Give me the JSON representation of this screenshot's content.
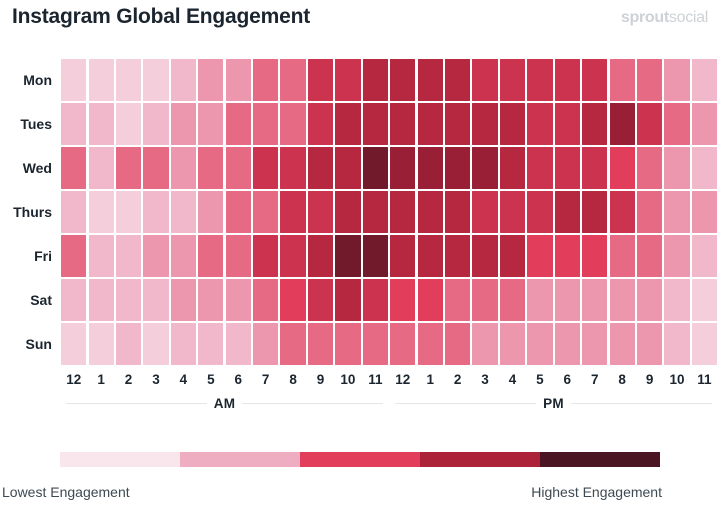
{
  "header": {
    "title": "Instagram Global Engagement",
    "brand_strong": "sprout",
    "brand_light": "social"
  },
  "legend": {
    "low_label": "Lowest Engagement",
    "high_label": "Highest Engagement",
    "swatches": [
      "#f8e6ec",
      "#eeadc1",
      "#e23e5c",
      "#ab2239",
      "#4a1423"
    ]
  },
  "axis": {
    "am_label": "AM",
    "pm_label": "PM",
    "hours": [
      "12",
      "1",
      "2",
      "3",
      "4",
      "5",
      "6",
      "7",
      "8",
      "9",
      "10",
      "11",
      "12",
      "1",
      "2",
      "3",
      "4",
      "5",
      "6",
      "7",
      "8",
      "9",
      "10",
      "11"
    ]
  },
  "chart_data": {
    "type": "heatmap",
    "title": "Instagram Global Engagement",
    "xlabel": "",
    "ylabel": "",
    "x": [
      "12 AM",
      "1 AM",
      "2 AM",
      "3 AM",
      "4 AM",
      "5 AM",
      "6 AM",
      "7 AM",
      "8 AM",
      "9 AM",
      "10 AM",
      "11 AM",
      "12 PM",
      "1 PM",
      "2 PM",
      "3 PM",
      "4 PM",
      "5 PM",
      "6 PM",
      "7 PM",
      "8 PM",
      "9 PM",
      "10 PM",
      "11 PM"
    ],
    "y": [
      "Mon",
      "Tues",
      "Wed",
      "Thurs",
      "Fri",
      "Sat",
      "Sun"
    ],
    "zmin": 0,
    "zmax": 10,
    "colorscale": [
      "#f8e6ec",
      "#eeadc1",
      "#e23e5c",
      "#ab2239",
      "#4a1423"
    ],
    "legend_position": "bottom",
    "grid": false,
    "annotations": [
      "Lowest Engagement",
      "Highest Engagement"
    ],
    "values": [
      [
        1,
        1,
        1,
        1,
        2,
        3,
        3,
        4,
        4,
        6,
        6,
        7,
        7,
        7,
        7,
        6,
        6,
        6,
        6,
        6,
        4,
        4,
        3,
        2
      ],
      [
        2,
        2,
        1,
        2,
        3,
        3,
        4,
        4,
        4,
        6,
        7,
        7,
        7,
        7,
        7,
        7,
        7,
        6,
        6,
        7,
        8,
        6,
        4,
        3
      ],
      [
        4,
        2,
        4,
        4,
        3,
        4,
        4,
        6,
        6,
        7,
        7,
        9,
        8,
        8,
        8,
        8,
        7,
        6,
        6,
        6,
        5,
        4,
        3,
        2
      ],
      [
        2,
        1,
        1,
        2,
        2,
        3,
        4,
        4,
        6,
        6,
        7,
        7,
        7,
        7,
        7,
        6,
        6,
        6,
        7,
        7,
        6,
        4,
        3,
        3
      ],
      [
        4,
        2,
        2,
        3,
        3,
        4,
        4,
        6,
        6,
        7,
        9,
        9,
        7,
        7,
        7,
        7,
        7,
        5,
        5,
        5,
        4,
        4,
        3,
        2
      ],
      [
        2,
        2,
        2,
        2,
        3,
        3,
        3,
        4,
        5,
        6,
        7,
        6,
        5,
        5,
        4,
        4,
        4,
        3,
        3,
        3,
        3,
        3,
        2,
        1
      ],
      [
        1,
        1,
        2,
        1,
        2,
        2,
        2,
        3,
        4,
        4,
        4,
        4,
        4,
        4,
        4,
        3,
        3,
        3,
        3,
        3,
        3,
        3,
        2,
        1
      ]
    ]
  }
}
